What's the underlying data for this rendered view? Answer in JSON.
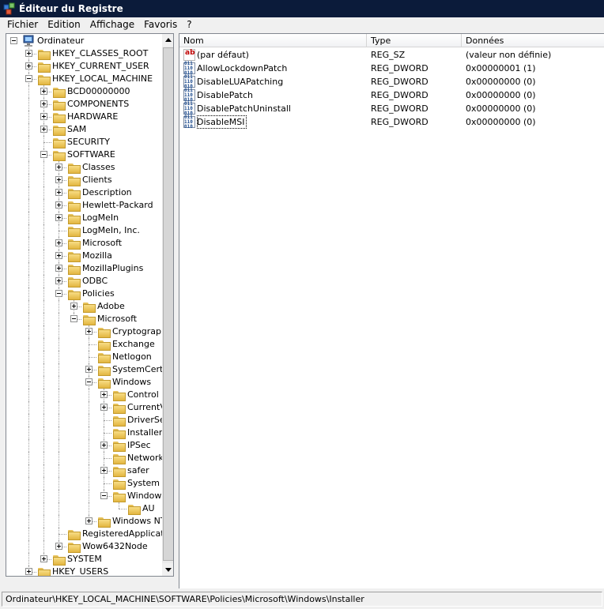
{
  "window": {
    "title": "Éditeur du Registre"
  },
  "menu": [
    "Fichier",
    "Edition",
    "Affichage",
    "Favoris",
    "?"
  ],
  "tree": [
    {
      "label": "Ordinateur",
      "level": 0,
      "expander": "minus",
      "icon": "computer-icon"
    },
    {
      "label": "HKEY_CLASSES_ROOT",
      "level": 1,
      "expander": "plus",
      "icon": "folder-icon"
    },
    {
      "label": "HKEY_CURRENT_USER",
      "level": 1,
      "expander": "plus",
      "icon": "folder-icon"
    },
    {
      "label": "HKEY_LOCAL_MACHINE",
      "level": 1,
      "expander": "minus",
      "icon": "folder-icon"
    },
    {
      "label": "BCD00000000",
      "level": 2,
      "expander": "plus",
      "icon": "folder-icon"
    },
    {
      "label": "COMPONENTS",
      "level": 2,
      "expander": "plus",
      "icon": "folder-icon"
    },
    {
      "label": "HARDWARE",
      "level": 2,
      "expander": "plus",
      "icon": "folder-icon"
    },
    {
      "label": "SAM",
      "level": 2,
      "expander": "plus",
      "icon": "folder-icon"
    },
    {
      "label": "SECURITY",
      "level": 2,
      "expander": "none",
      "icon": "folder-icon"
    },
    {
      "label": "SOFTWARE",
      "level": 2,
      "expander": "minus",
      "icon": "folder-icon"
    },
    {
      "label": "Classes",
      "level": 3,
      "expander": "plus",
      "icon": "folder-icon"
    },
    {
      "label": "Clients",
      "level": 3,
      "expander": "plus",
      "icon": "folder-icon"
    },
    {
      "label": "Description",
      "level": 3,
      "expander": "plus",
      "icon": "folder-icon"
    },
    {
      "label": "Hewlett-Packard",
      "level": 3,
      "expander": "plus",
      "icon": "folder-icon"
    },
    {
      "label": "LogMeIn",
      "level": 3,
      "expander": "plus",
      "icon": "folder-icon"
    },
    {
      "label": "LogMeIn, Inc.",
      "level": 3,
      "expander": "none",
      "icon": "folder-icon"
    },
    {
      "label": "Microsoft",
      "level": 3,
      "expander": "plus",
      "icon": "folder-icon"
    },
    {
      "label": "Mozilla",
      "level": 3,
      "expander": "plus",
      "icon": "folder-icon"
    },
    {
      "label": "MozillaPlugins",
      "level": 3,
      "expander": "plus",
      "icon": "folder-icon"
    },
    {
      "label": "ODBC",
      "level": 3,
      "expander": "plus",
      "icon": "folder-icon"
    },
    {
      "label": "Policies",
      "level": 3,
      "expander": "minus",
      "icon": "folder-icon"
    },
    {
      "label": "Adobe",
      "level": 4,
      "expander": "plus",
      "icon": "folder-icon"
    },
    {
      "label": "Microsoft",
      "level": 4,
      "expander": "minus",
      "icon": "folder-icon"
    },
    {
      "label": "Cryptograph",
      "level": 5,
      "expander": "plus",
      "icon": "folder-icon"
    },
    {
      "label": "Exchange",
      "level": 5,
      "expander": "none",
      "icon": "folder-icon"
    },
    {
      "label": "Netlogon",
      "level": 5,
      "expander": "none",
      "icon": "folder-icon"
    },
    {
      "label": "SystemCerti",
      "level": 5,
      "expander": "plus",
      "icon": "folder-icon"
    },
    {
      "label": "Windows",
      "level": 5,
      "expander": "minus",
      "icon": "folder-icon"
    },
    {
      "label": "Control P",
      "level": 6,
      "expander": "plus",
      "icon": "folder-icon"
    },
    {
      "label": "CurrentV",
      "level": 6,
      "expander": "plus",
      "icon": "folder-icon"
    },
    {
      "label": "DriverSe",
      "level": 6,
      "expander": "none",
      "icon": "folder-icon"
    },
    {
      "label": "Installer",
      "level": 6,
      "expander": "none",
      "icon": "folder-icon"
    },
    {
      "label": "IPSec",
      "level": 6,
      "expander": "plus",
      "icon": "folder-icon"
    },
    {
      "label": "Network",
      "level": 6,
      "expander": "none",
      "icon": "folder-icon"
    },
    {
      "label": "safer",
      "level": 6,
      "expander": "plus",
      "icon": "folder-icon"
    },
    {
      "label": "System",
      "level": 6,
      "expander": "none",
      "icon": "folder-icon"
    },
    {
      "label": "Windows",
      "level": 6,
      "expander": "minus",
      "icon": "folder-icon"
    },
    {
      "label": "AU",
      "level": 7,
      "expander": "none",
      "icon": "folder-icon"
    },
    {
      "label": "Windows NT",
      "level": 5,
      "expander": "plus",
      "icon": "folder-icon"
    },
    {
      "label": "RegisteredApplicatio",
      "level": 3,
      "expander": "none",
      "icon": "folder-icon"
    },
    {
      "label": "Wow6432Node",
      "level": 3,
      "expander": "plus",
      "icon": "folder-icon"
    },
    {
      "label": "SYSTEM",
      "level": 2,
      "expander": "plus",
      "icon": "folder-icon"
    },
    {
      "label": "HKEY_USERS",
      "level": 1,
      "expander": "plus",
      "icon": "folder-icon"
    }
  ],
  "list": {
    "columns": [
      "Nom",
      "Type",
      "Données"
    ],
    "rows": [
      {
        "name": "(par défaut)",
        "type": "REG_SZ",
        "data": "(valeur non définie)",
        "icon": "string-value-icon"
      },
      {
        "name": "AllowLockdownPatch",
        "type": "REG_DWORD",
        "data": "0x00000001 (1)",
        "icon": "dword-value-icon"
      },
      {
        "name": "DisableLUAPatching",
        "type": "REG_DWORD",
        "data": "0x00000000 (0)",
        "icon": "dword-value-icon"
      },
      {
        "name": "DisablePatch",
        "type": "REG_DWORD",
        "data": "0x00000000 (0)",
        "icon": "dword-value-icon"
      },
      {
        "name": "DisablePatchUninstall",
        "type": "REG_DWORD",
        "data": "0x00000000 (0)",
        "icon": "dword-value-icon"
      },
      {
        "name": "DisableMSI",
        "type": "REG_DWORD",
        "data": "0x00000000 (0)",
        "icon": "dword-value-icon"
      }
    ]
  },
  "status": {
    "path": "Ordinateur\\HKEY_LOCAL_MACHINE\\SOFTWARE\\Policies\\Microsoft\\Windows\\Installer"
  }
}
